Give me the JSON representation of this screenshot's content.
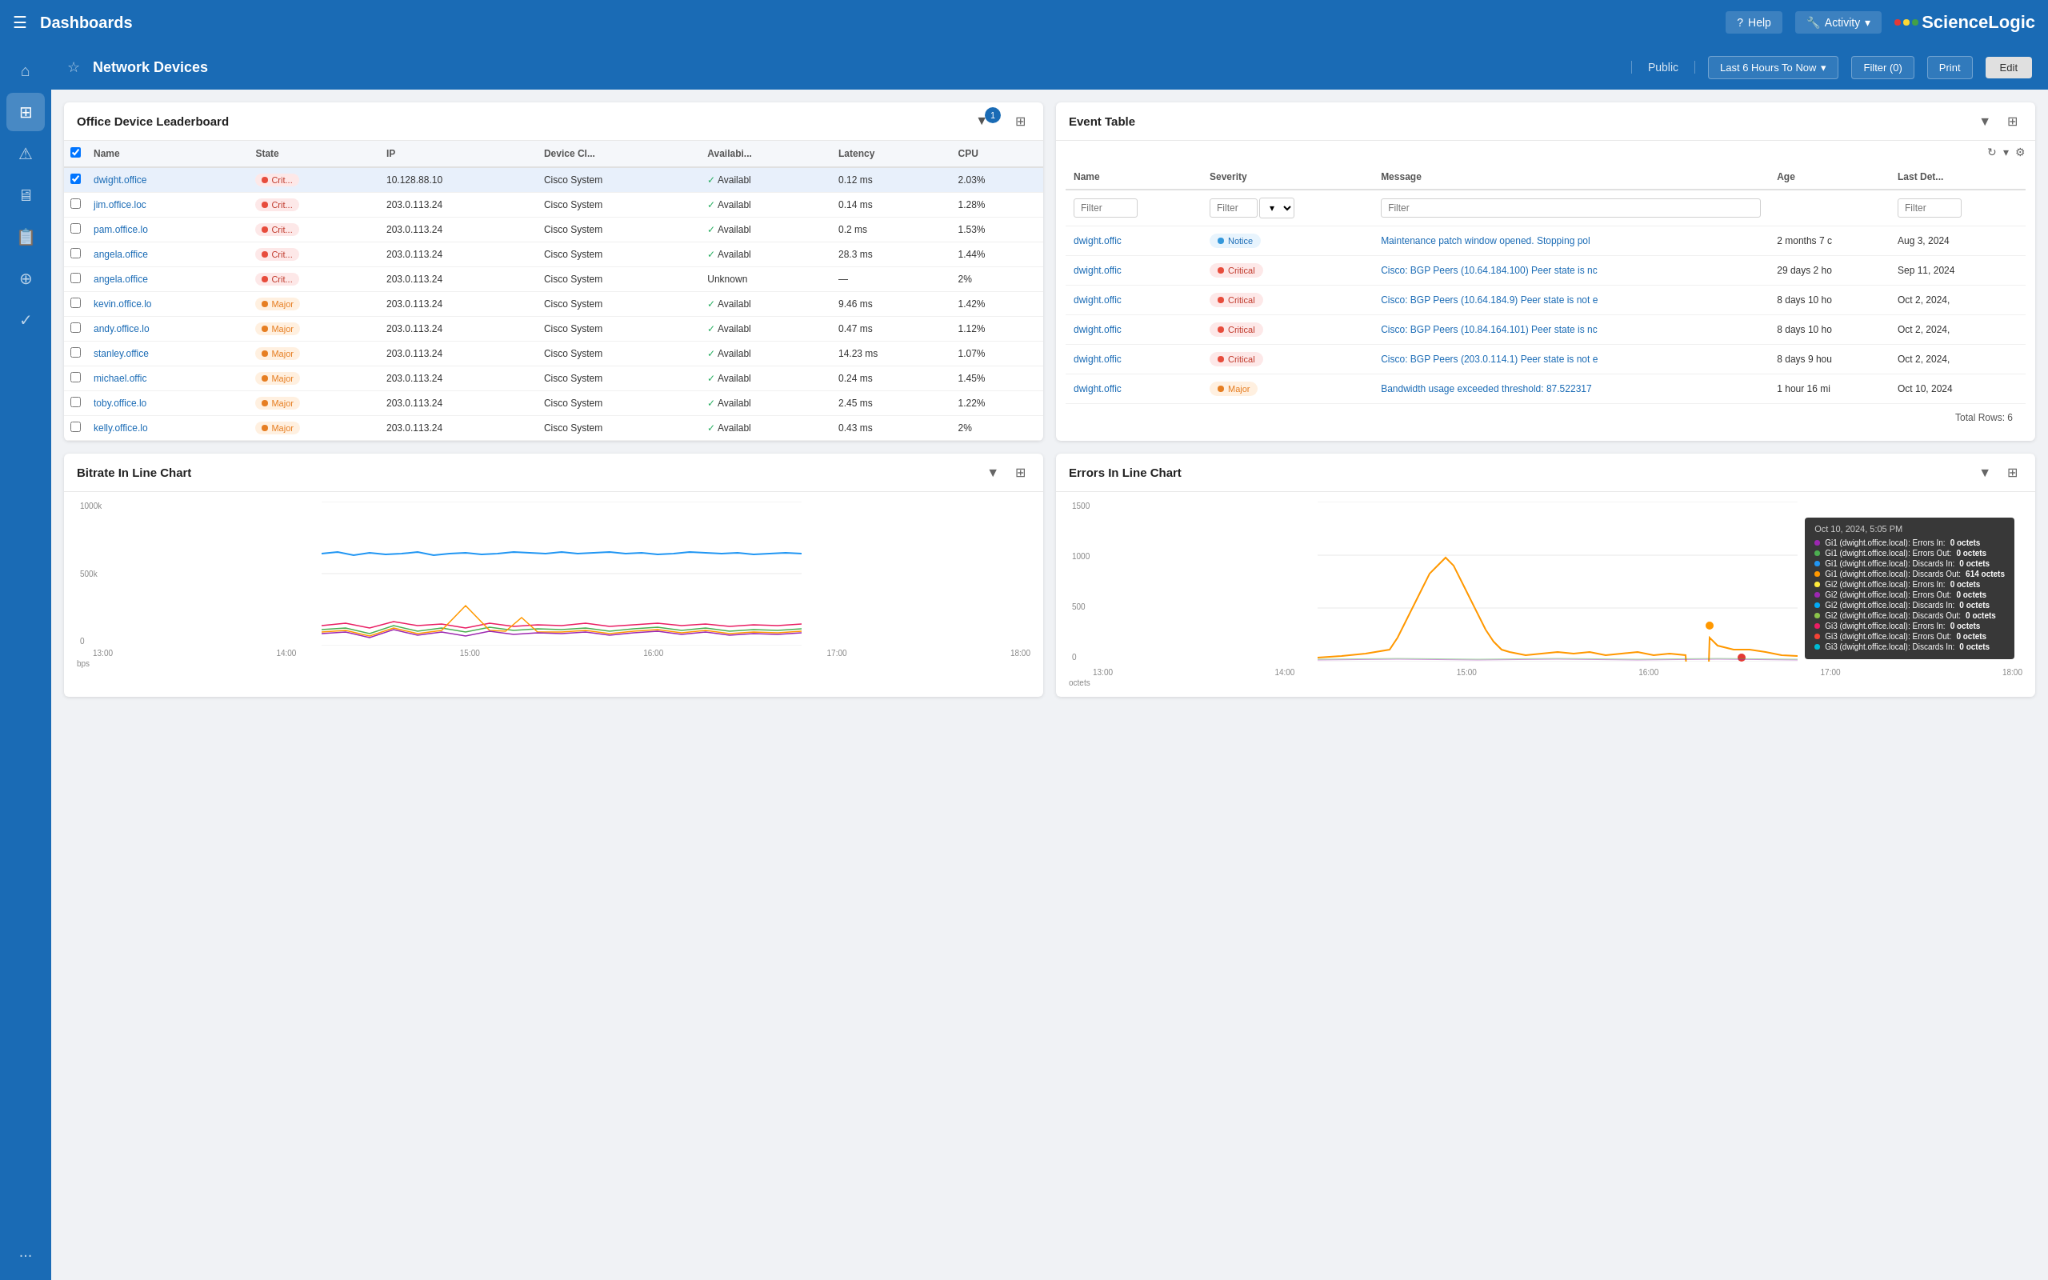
{
  "app": {
    "title": "Dashboards",
    "logo": "ScienceLogic",
    "help_label": "Help",
    "activity_label": "Activity"
  },
  "sidebar": {
    "items": [
      {
        "name": "home",
        "icon": "⌂"
      },
      {
        "name": "dashboard",
        "icon": "⊞"
      },
      {
        "name": "alert",
        "icon": "⚠"
      },
      {
        "name": "devices",
        "icon": "🖥"
      },
      {
        "name": "reports",
        "icon": "📋"
      },
      {
        "name": "groups",
        "icon": "⊕"
      },
      {
        "name": "tasks",
        "icon": "✓"
      },
      {
        "name": "more",
        "icon": "···"
      }
    ]
  },
  "dashboard_header": {
    "title": "Network Devices",
    "public_label": "Public",
    "time_label": "Last 6 Hours To Now",
    "filter_label": "Filter (0)",
    "print_label": "Print",
    "edit_label": "Edit"
  },
  "office_leaderboard": {
    "title": "Office Device Leaderboard",
    "badge": "1",
    "columns": [
      "Name",
      "State",
      "IP",
      "Device Cl...",
      "Availabi...",
      "Latency",
      "CPU"
    ],
    "rows": [
      {
        "selected": true,
        "name": "dwight.office",
        "state": "Crit...",
        "state_type": "critical",
        "ip": "10.128.88.10",
        "device_class": "Cisco System",
        "avail": "Availabl",
        "latency": "0.12 ms",
        "cpu": "2.03%"
      },
      {
        "selected": false,
        "name": "jim.office.loc",
        "state": "Crit...",
        "state_type": "critical",
        "ip": "203.0.113.24",
        "device_class": "Cisco System",
        "avail": "Availabl",
        "latency": "0.14 ms",
        "cpu": "1.28%"
      },
      {
        "selected": false,
        "name": "pam.office.lo",
        "state": "Crit...",
        "state_type": "critical",
        "ip": "203.0.113.24",
        "device_class": "Cisco System",
        "avail": "Availabl",
        "latency": "0.2 ms",
        "cpu": "1.53%"
      },
      {
        "selected": false,
        "name": "angela.office",
        "state": "Crit...",
        "state_type": "critical",
        "ip": "203.0.113.24",
        "device_class": "Cisco System",
        "avail": "Availabl",
        "latency": "28.3 ms",
        "cpu": "1.44%"
      },
      {
        "selected": false,
        "name": "angela.office",
        "state": "Crit...",
        "state_type": "critical",
        "ip": "203.0.113.24",
        "device_class": "Cisco System",
        "avail": "Unknown",
        "latency": "—",
        "cpu": "2%"
      },
      {
        "selected": false,
        "name": "kevin.office.lo",
        "state": "Major",
        "state_type": "major",
        "ip": "203.0.113.24",
        "device_class": "Cisco System",
        "avail": "Availabl",
        "latency": "9.46 ms",
        "cpu": "1.42%"
      },
      {
        "selected": false,
        "name": "andy.office.lo",
        "state": "Major",
        "state_type": "major",
        "ip": "203.0.113.24",
        "device_class": "Cisco System",
        "avail": "Availabl",
        "latency": "0.47 ms",
        "cpu": "1.12%"
      },
      {
        "selected": false,
        "name": "stanley.office",
        "state": "Major",
        "state_type": "major",
        "ip": "203.0.113.24",
        "device_class": "Cisco System",
        "avail": "Availabl",
        "latency": "14.23 ms",
        "cpu": "1.07%"
      },
      {
        "selected": false,
        "name": "michael.offic",
        "state": "Major",
        "state_type": "major",
        "ip": "203.0.113.24",
        "device_class": "Cisco System",
        "avail": "Availabl",
        "latency": "0.24 ms",
        "cpu": "1.45%"
      },
      {
        "selected": false,
        "name": "toby.office.lo",
        "state": "Major",
        "state_type": "major",
        "ip": "203.0.113.24",
        "device_class": "Cisco System",
        "avail": "Availabl",
        "latency": "2.45 ms",
        "cpu": "1.22%"
      },
      {
        "selected": false,
        "name": "kelly.office.lo",
        "state": "Major",
        "state_type": "major",
        "ip": "203.0.113.24",
        "device_class": "Cisco System",
        "avail": "Availabl",
        "latency": "0.43 ms",
        "cpu": "2%"
      }
    ]
  },
  "event_table": {
    "title": "Event Table",
    "columns": [
      "Name",
      "Severity",
      "Message",
      "Age",
      "Last Det..."
    ],
    "filters": [
      "Filter",
      "Filter",
      "Filter",
      "Filter"
    ],
    "rows": [
      {
        "name": "dwight.offic",
        "severity": "Notice",
        "sev_type": "notice",
        "message": "Maintenance patch window opened. Stopping pol",
        "age": "2 months 7 c",
        "last_det": "Aug 3, 2024"
      },
      {
        "name": "dwight.offic",
        "severity": "Critical",
        "sev_type": "critical",
        "message": "Cisco: BGP Peers (10.64.184.100) Peer state is nc",
        "age": "29 days 2 ho",
        "last_det": "Sep 11, 2024"
      },
      {
        "name": "dwight.offic",
        "severity": "Critical",
        "sev_type": "critical",
        "message": "Cisco: BGP Peers (10.64.184.9) Peer state is not e",
        "age": "8 days 10 ho",
        "last_det": "Oct 2, 2024,"
      },
      {
        "name": "dwight.offic",
        "severity": "Critical",
        "sev_type": "critical",
        "message": "Cisco: BGP Peers (10.84.164.101) Peer state is nc",
        "age": "8 days 10 ho",
        "last_det": "Oct 2, 2024,"
      },
      {
        "name": "dwight.offic",
        "severity": "Critical",
        "sev_type": "critical",
        "message": "Cisco: BGP Peers (203.0.114.1) Peer state is not e",
        "age": "8 days 9 hou",
        "last_det": "Oct 2, 2024,"
      },
      {
        "name": "dwight.offic",
        "severity": "Major",
        "sev_type": "major",
        "message": "Bandwidth usage exceeded threshold: 87.522317",
        "age": "1 hour 16 mi",
        "last_det": "Oct 10, 2024"
      }
    ],
    "total_rows": "Total Rows: 6"
  },
  "bitrate_chart": {
    "title": "Bitrate In Line Chart",
    "y_label": "bps",
    "y_ticks": [
      "1000k",
      "500k",
      "0"
    ],
    "x_ticks": [
      "13:00",
      "14:00",
      "15:00",
      "16:00",
      "17:00",
      "18:00"
    ]
  },
  "errors_chart": {
    "title": "Errors In Line Chart",
    "y_label": "octets",
    "y_ticks": [
      "1500",
      "1000",
      "500",
      "0"
    ],
    "x_ticks": [
      "13:00",
      "14:00",
      "15:00",
      "16:00",
      "17:00",
      "18:00"
    ],
    "tooltip": {
      "title": "Oct 10, 2024, 5:05 PM",
      "rows": [
        {
          "color": "#9c27b0",
          "label": "Gi1 (dwight.office.local): Errors In:",
          "value": "0 octets"
        },
        {
          "color": "#4caf50",
          "label": "Gi1 (dwight.office.local): Errors Out:",
          "value": "0 octets"
        },
        {
          "color": "#2196f3",
          "label": "Gi1 (dwight.office.local): Discards In:",
          "value": "0 octets"
        },
        {
          "color": "#ff9800",
          "label": "Gi1 (dwight.office.local): Discards Out:",
          "value": "614 octets"
        },
        {
          "color": "#ffeb3b",
          "label": "Gi2 (dwight.office.local): Errors In:",
          "value": "0 octets"
        },
        {
          "color": "#9c27b0",
          "label": "Gi2 (dwight.office.local): Errors Out:",
          "value": "0 octets"
        },
        {
          "color": "#03a9f4",
          "label": "Gi2 (dwight.office.local): Discards In:",
          "value": "0 octets"
        },
        {
          "color": "#8bc34a",
          "label": "Gi2 (dwight.office.local): Discards Out:",
          "value": "0 octets"
        },
        {
          "color": "#e91e63",
          "label": "Gi3 (dwight.office.local): Errors In:",
          "value": "0 octets"
        },
        {
          "color": "#f44336",
          "label": "Gi3 (dwight.office.local): Errors Out:",
          "value": "0 octets"
        },
        {
          "color": "#00bcd4",
          "label": "Gi3 (dwight.office.local): Discards In:",
          "value": "0 octets"
        }
      ]
    }
  }
}
